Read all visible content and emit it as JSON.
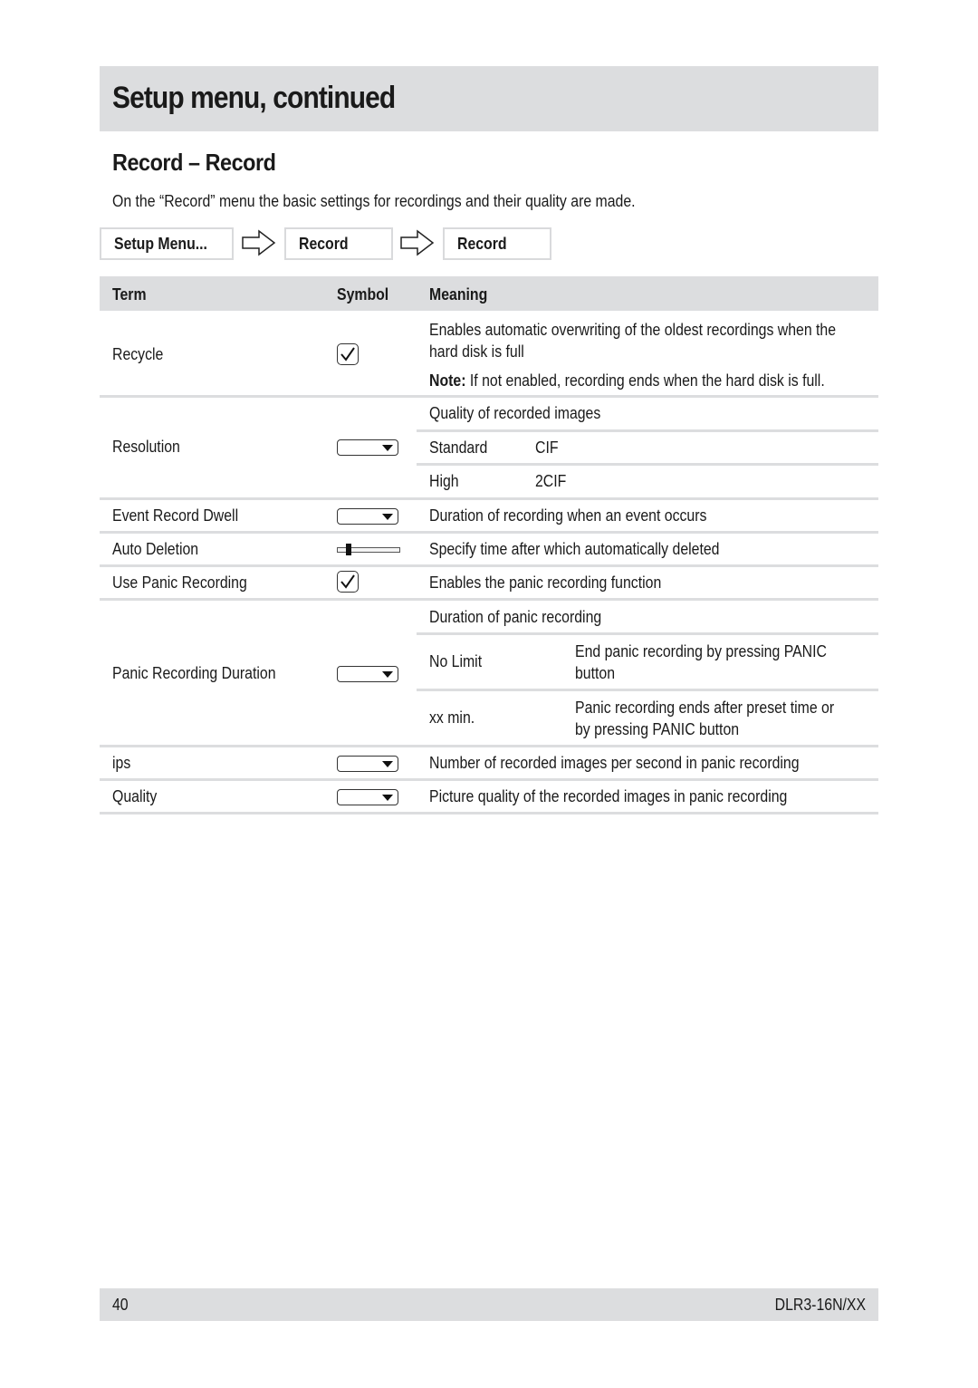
{
  "header": {
    "title": "Setup menu, continued"
  },
  "section": {
    "title": "Record – Record",
    "intro": "On the “Record” menu the basic settings for recordings and their quality are made."
  },
  "breadcrumb": [
    "Setup Menu...",
    "Record",
    "Record"
  ],
  "table": {
    "headers": {
      "term": "Term",
      "symbol": "Symbol",
      "meaning": "Meaning"
    },
    "rows": [
      {
        "term": "Recycle",
        "symbol": "checkbox-icon",
        "meaning_line1": "Enables automatic overwriting of the oldest recordings when the",
        "meaning_line2": "hard disk is full",
        "note_label": "Note:",
        "note_text": " If not enabled, recording ends when the hard disk is full."
      },
      {
        "term": "Resolution",
        "symbol": "dropdown-icon",
        "meaning": "Quality of recorded images",
        "options": [
          {
            "name": "Standard",
            "value": "CIF"
          },
          {
            "name": "High",
            "value": "2CIF"
          }
        ]
      },
      {
        "term": "Event Record Dwell",
        "symbol": "dropdown-icon",
        "meaning": "Duration of recording when an event occurs"
      },
      {
        "term": "Auto Deletion",
        "symbol": "slider-icon",
        "meaning": "Specify time after which automatically deleted"
      },
      {
        "term": "Use Panic Recording",
        "symbol": "checkbox-icon",
        "meaning": "Enables the panic recording function"
      },
      {
        "term": "Panic Recording Duration",
        "symbol": "dropdown-icon",
        "meaning": "Duration of panic recording",
        "options": [
          {
            "name": "No Limit",
            "desc_line1": "End panic recording by pressing PANIC",
            "desc_line2": "button"
          },
          {
            "name": "xx min.",
            "desc_line1": "Panic recording ends after preset time or",
            "desc_line2": "by pressing PANIC button"
          }
        ]
      },
      {
        "term": "ips",
        "symbol": "dropdown-icon",
        "meaning": "Number of recorded images per second in panic recording"
      },
      {
        "term": "Quality",
        "symbol": "dropdown-icon",
        "meaning": "Picture quality of the recorded images in panic recording"
      }
    ]
  },
  "footer": {
    "page_number": "40",
    "model": "DLR3-16N/XX"
  }
}
